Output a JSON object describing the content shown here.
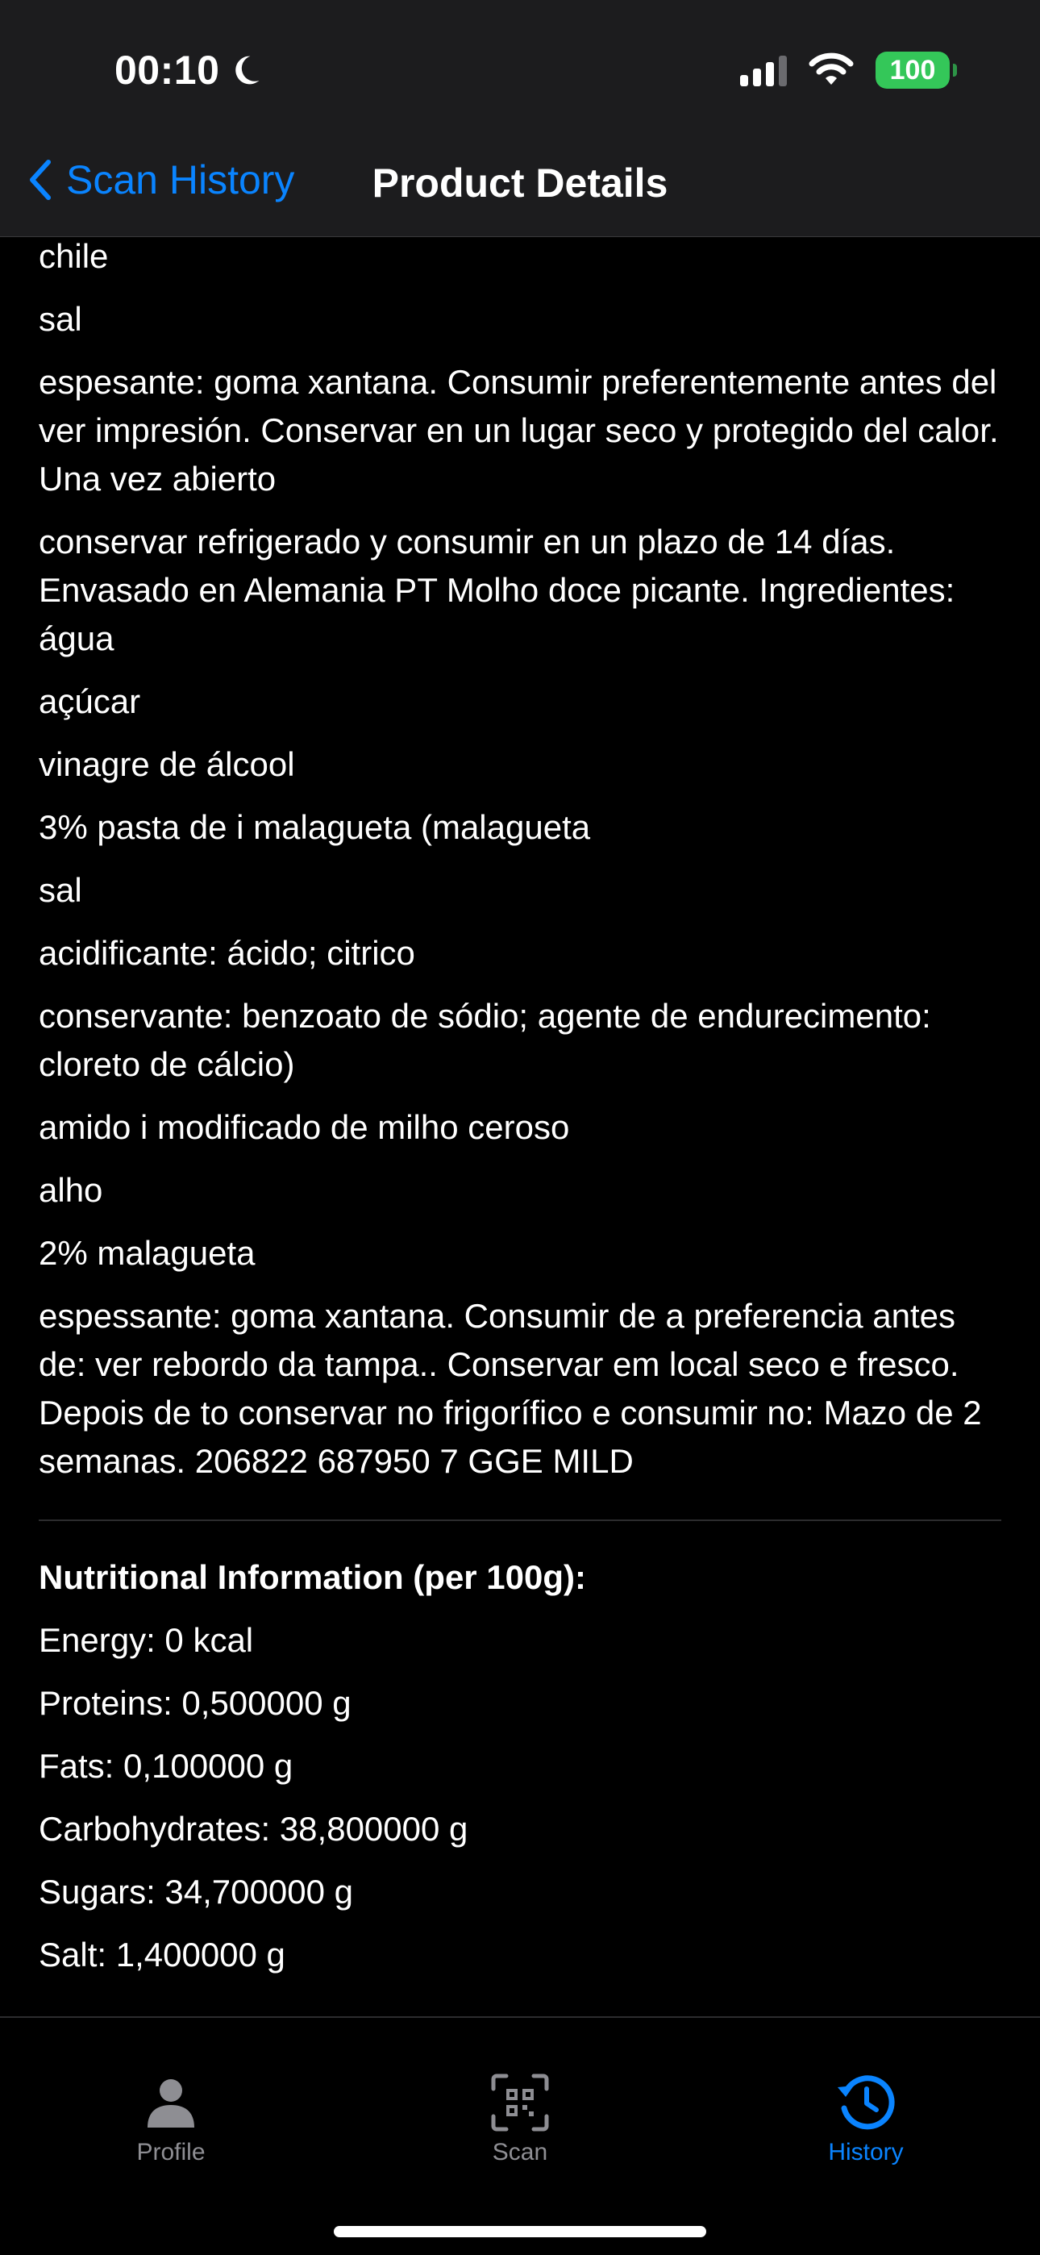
{
  "status": {
    "time": "00:10",
    "battery": "100"
  },
  "nav": {
    "back_label": "Scan History",
    "title": "Product Details"
  },
  "ingredients": [
    " chile",
    " sal",
    " espesante: goma xantana. Consumir preferentemente antes del ver impresión. Conservar en un lugar seco y protegido del calor. Una vez abierto",
    " conservar refrigerado y consumir en un plazo de 14 días. Envasado en Alemania PT Molho doce picante. Ingredientes: água",
    " açúcar",
    " vinagre de álcool",
    " 3% pasta de i malagueta (malagueta",
    " sal",
    " acidificante: ácido; citrico",
    " conservante: benzoato de sódio; agente de endurecimento: cloreto de cálcio)",
    " amido i modificado de milho ceroso",
    " alho",
    " 2% malagueta",
    " espessante: goma xantana. Consumir de a preferencia antes de: ver rebordo da tampa.. Conservar em local seco e fresco. Depois de to conservar no frigorífico e consumir no: Mazo de 2 semanas. 206822 687950 7 GGE MILD"
  ],
  "nutrition": {
    "title": "Nutritional Information (per 100g):",
    "rows": [
      "Energy: 0 kcal",
      "Proteins: 0,500000 g",
      "Fats: 0,100000 g",
      "Carbohydrates: 38,800000 g",
      "Sugars: 34,700000 g",
      "Salt: 1,400000 g"
    ]
  },
  "tabs": [
    {
      "label": "Profile",
      "icon": "person-icon",
      "active": false
    },
    {
      "label": "Scan",
      "icon": "qr-scan-icon",
      "active": false
    },
    {
      "label": "History",
      "icon": "history-clock-icon",
      "active": true
    }
  ],
  "colors": {
    "accent": "#0a84ff",
    "battery": "#34c759",
    "inactive": "#8e8e93"
  }
}
